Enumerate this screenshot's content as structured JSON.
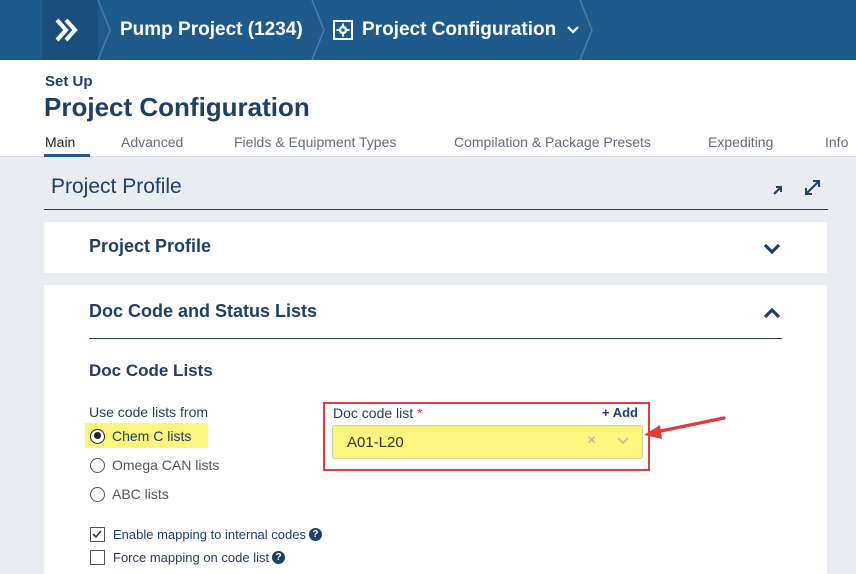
{
  "breadcrumb": {
    "project": "Pump Project (1234)",
    "config": "Project Configuration"
  },
  "header": {
    "setup": "Set Up",
    "title": "Project Configuration"
  },
  "tabs": [
    {
      "label": "Main"
    },
    {
      "label": "Advanced"
    },
    {
      "label": "Fields & Equipment Types"
    },
    {
      "label": "Compilation & Package Presets"
    },
    {
      "label": "Expediting"
    },
    {
      "label": "Info"
    }
  ],
  "profile": {
    "header": "Project Profile",
    "card1_title": "Project Profile",
    "card2_title": "Doc Code and Status Lists",
    "subheading": "Doc Code Lists",
    "use_label": "Use code lists from",
    "radios": [
      "Chem C lists",
      "Omega CAN lists",
      "ABC lists"
    ],
    "checks": [
      {
        "label": "Enable mapping to internal codes",
        "checked": true
      },
      {
        "label": "Force mapping on code list",
        "checked": false
      }
    ],
    "doc_code_label": "Doc code list",
    "required_mark": "*",
    "add_label": "Add",
    "add_symbol": "+",
    "doc_code_value": "A01-L20",
    "clear_symbol": "×"
  },
  "colors": {
    "topbar": "#1f5a8c",
    "navy": "#1e3f66",
    "highlight": "#fbf57e",
    "annotation_red": "#e23b3b"
  }
}
